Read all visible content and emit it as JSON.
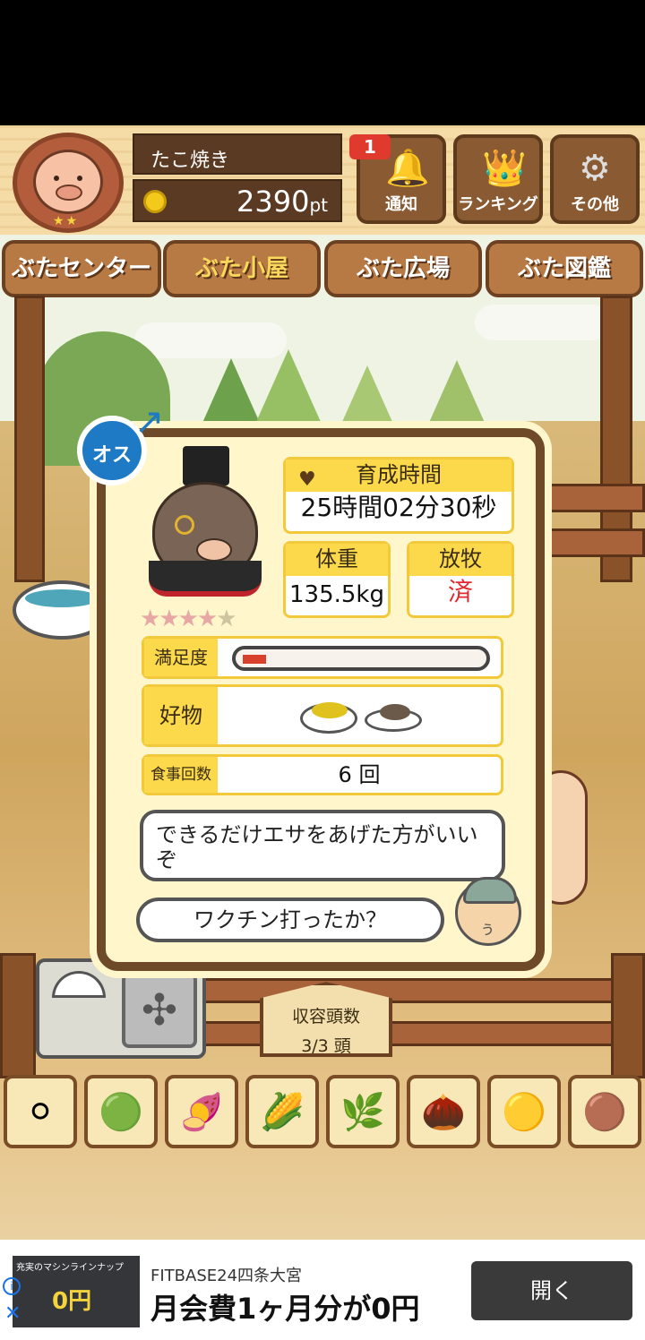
{
  "header": {
    "player_name": "たこ焼き",
    "points": "2390",
    "points_unit": "pt",
    "notification_count": "1",
    "buttons": [
      {
        "label": "通知",
        "icon": "bell-icon",
        "glyph": "🔔"
      },
      {
        "label": "ランキング",
        "icon": "crown-icon",
        "glyph": "👑"
      },
      {
        "label": "その他",
        "icon": "gear-icon",
        "glyph": "⚙"
      }
    ]
  },
  "tabs": [
    "ぶたセンター",
    "ぶた小屋",
    "ぶた広場",
    "ぶた図鑑"
  ],
  "active_tab": "ぶた小屋",
  "pig": {
    "gender": "オス",
    "stars_filled": 4,
    "stars_total": 5,
    "raising_time_label": "育成時間",
    "raising_time": "25時間02分30秒",
    "weight_label": "体重",
    "weight": "135.5kg",
    "grazing_label": "放牧",
    "grazing": "済",
    "satisfaction_label": "満足度",
    "satisfaction_level": 0.06,
    "favorite_label": "好物",
    "favorite_foods": [
      "corn-dish-icon",
      "acorn-dish-icon"
    ],
    "meals_label": "食事回数",
    "meals": "6 回"
  },
  "farmer": {
    "speech_1": "できるだけエサをあげた方がいいぞ",
    "speech_2": "ワクチン打ったか？"
  },
  "capacity": {
    "label": "収容頭数",
    "value": "3/3 頭"
  },
  "food_tray": [
    {
      "name": "soybean-icon",
      "glyph": "⚪"
    },
    {
      "name": "mixed-bean-icon",
      "glyph": "🟢"
    },
    {
      "name": "sweet-potato-icon",
      "glyph": "🍠"
    },
    {
      "name": "corn-icon",
      "glyph": "🌽"
    },
    {
      "name": "leaf-bean-icon",
      "glyph": "🌿"
    },
    {
      "name": "acorn-icon",
      "glyph": "🌰"
    },
    {
      "name": "corn-dish-icon",
      "glyph": "🟡"
    },
    {
      "name": "acorn-dish-icon",
      "glyph": "🟤"
    }
  ],
  "ad": {
    "image_caption": "充実のマシンラインナップ",
    "image_price": "0円",
    "brand": "FITBASE24四条大宮",
    "title": "月会費1ヶ月分が0円",
    "cta": "開く"
  },
  "colors": {
    "wood_dark": "#6e4a28",
    "card_yellow": "#fbd94a",
    "grazing_red": "#e0282e",
    "male_blue": "#1e7ac5"
  }
}
